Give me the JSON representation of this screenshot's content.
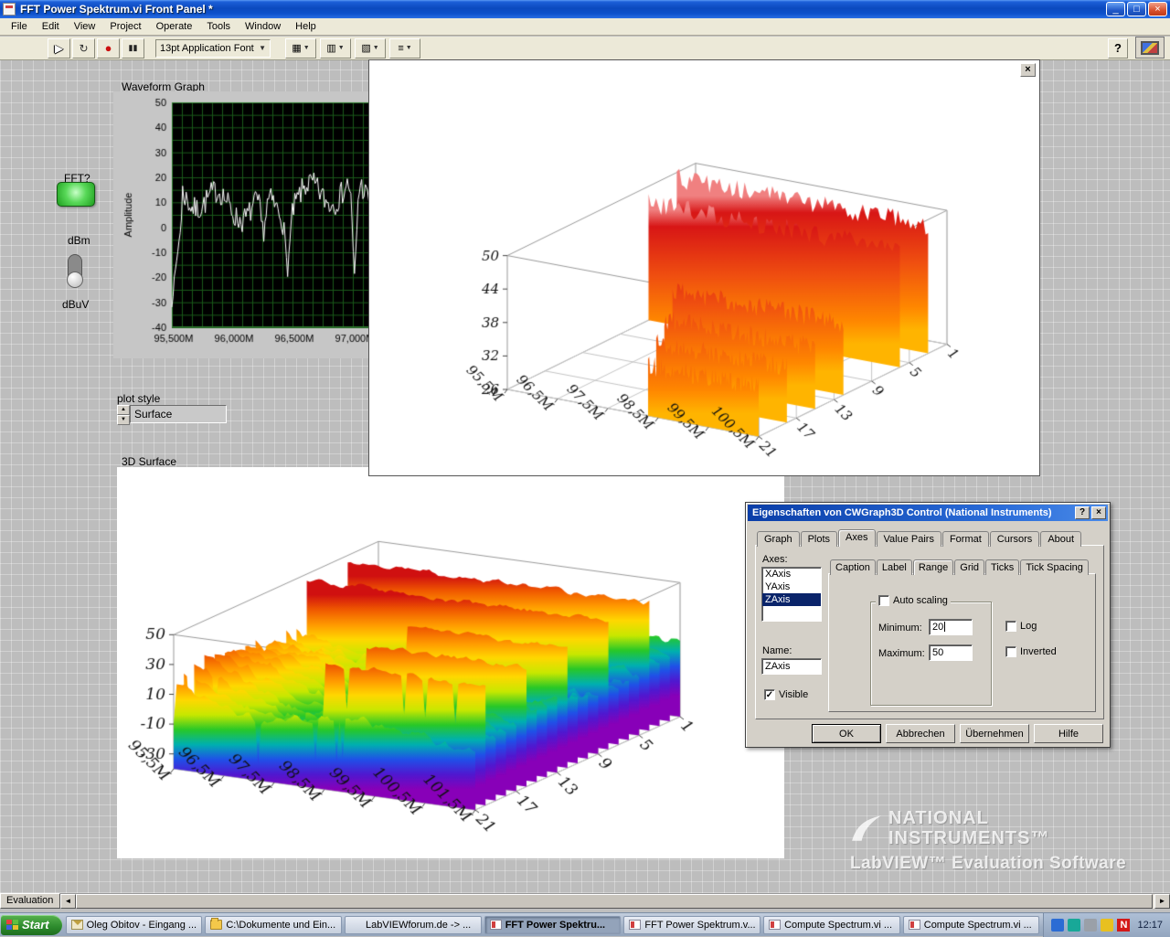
{
  "window": {
    "title": "FFT Power Spektrum.vi Front Panel *",
    "controls": {
      "minimize": "_",
      "maximize": "□",
      "close": "×"
    },
    "menu": [
      "File",
      "Edit",
      "View",
      "Project",
      "Operate",
      "Tools",
      "Window",
      "Help"
    ],
    "toolbar": {
      "run_icon": "▶",
      "run_continuous_icon": "↻",
      "abort_icon": "●",
      "pause_icon": "▮▮",
      "font_selector": "13pt Application Font",
      "dropdown_arrow": "▼",
      "align_icon": "▦",
      "distribute_icon": "▥",
      "resize_icon": "▧",
      "reorder_icon": "≡",
      "help_label": "?"
    }
  },
  "panel": {
    "waveform_label": "Waveform Graph",
    "fft_label": "FFT?",
    "dbm_label": "dBm",
    "dbuv_label": "dBuV",
    "plot_style_label": "plot style",
    "plot_style_value": "Surface",
    "spinner_up": "▲",
    "spinner_down": "▼",
    "surface_label": "3D Surface"
  },
  "float_window": {
    "close": "×"
  },
  "dialog": {
    "title": "Eigenschaften von CWGraph3D Control  (National Instruments)",
    "help_button": "?",
    "close_button": "×",
    "tabs": [
      {
        "label": "Graph"
      },
      {
        "label": "Plots"
      },
      {
        "label": "Axes",
        "active": true
      },
      {
        "label": "Value Pairs"
      },
      {
        "label": "Format"
      },
      {
        "label": "Cursors"
      },
      {
        "label": "About"
      }
    ],
    "axes_label": "Axes:",
    "axes_list": [
      {
        "label": "XAxis"
      },
      {
        "label": "YAxis"
      },
      {
        "label": "ZAxis",
        "selected": true
      }
    ],
    "name_label": "Name:",
    "name_value": "ZAxis",
    "visible_label": "Visible",
    "visible_check": "✓",
    "subtabs": [
      {
        "label": "Caption"
      },
      {
        "label": "Label"
      },
      {
        "label": "Range",
        "active": true
      },
      {
        "label": "Grid"
      },
      {
        "label": "Ticks"
      },
      {
        "label": "Tick Spacing"
      }
    ],
    "auto_scaling_label": "Auto scaling",
    "auto_scaling_check": "",
    "minimum_label": "Minimum:",
    "minimum_value": "20",
    "maximum_label": "Maximum:",
    "maximum_value": "50",
    "log_label": "Log",
    "log_check": "",
    "inverted_label": "Inverted",
    "inverted_check": "",
    "buttons": [
      {
        "label": "OK",
        "default": true
      },
      {
        "label": "Abbrechen"
      },
      {
        "label": "Übernehmen"
      },
      {
        "label": "Hilfe"
      }
    ]
  },
  "watermark": {
    "line1": "NATIONAL",
    "line2": "INSTRUMENTS™",
    "line3": "LabVIEW™ Evaluation Software"
  },
  "statusbar": {
    "evaluation_label": "Evaluation",
    "scroll_left": "◄",
    "scroll_right": "►"
  },
  "taskbar": {
    "start_label": "Start",
    "items": [
      {
        "label": "Oleg Obitov - Eingang ...",
        "icon": "mail"
      },
      {
        "label": "C:\\Dokumente und Ein...",
        "icon": "folder"
      },
      {
        "label": "LabVIEWforum.de -> ...",
        "icon": "ie"
      },
      {
        "label": "FFT Power Spektru...",
        "icon": "labview",
        "active": true
      },
      {
        "label": "FFT Power Spektrum.v...",
        "icon": "labview"
      },
      {
        "label": "Compute Spectrum.vi ...",
        "icon": "labview"
      },
      {
        "label": "Compute Spectrum.vi ...",
        "icon": "labview"
      }
    ],
    "norton_glyph": "N",
    "clock": "12:17"
  },
  "chart_data": [
    {
      "id": "waveform",
      "type": "line",
      "title": "Waveform Graph",
      "ylabel": "Amplitude",
      "ylim": [
        -40,
        50
      ],
      "yticks": [
        50,
        40,
        30,
        20,
        10,
        0,
        -10,
        -20,
        -30,
        -40
      ],
      "xtick_labels": [
        "95,500M",
        "96,000M",
        "96,500M",
        "97,000M"
      ],
      "bg": "#000000",
      "grid_color": "#1a5a1a",
      "line_color": "#ffffff",
      "profile": {
        "start": -30,
        "rise_end_frac": 0.05,
        "mean": 11,
        "wobble": 5,
        "noise": 10,
        "dips": [
          {
            "center": 0.45,
            "depth": 14,
            "width": 0.012
          },
          {
            "center": 0.57,
            "depth": 20,
            "width": 0.012
          },
          {
            "center": 0.9,
            "depth": 38,
            "width": 0.01
          }
        ]
      },
      "seed": 7
    },
    {
      "id": "float3d",
      "type": "3d-curtain",
      "zlim": [
        26,
        50
      ],
      "ztick_values": [
        50,
        44,
        38,
        32,
        26
      ],
      "ztick_labels": [
        "50",
        "44",
        "38",
        "32",
        "26"
      ],
      "xlim": [
        0,
        5
      ],
      "xtick_values": [
        0,
        1,
        2,
        3,
        4,
        5
      ],
      "xtick_labels": [
        "95,5M",
        "96,5M",
        "97,5M",
        "98,5M",
        "99,5M",
        "100,5M"
      ],
      "ylim": [
        1,
        21
      ],
      "ytick_values": [
        1,
        5,
        9,
        13,
        17,
        21
      ],
      "ytick_labels": [
        "1",
        "5",
        "9",
        "13",
        "17",
        "21"
      ],
      "rows": [
        {
          "y": 3,
          "x0": 0,
          "x1": 5,
          "level": 49
        },
        {
          "y": 6,
          "x0": 0,
          "x1": 5,
          "level": 47
        },
        {
          "y": 12,
          "x0": 1.6,
          "x1": 5,
          "level": 39
        },
        {
          "y": 15,
          "x0": 2.0,
          "x1": 5,
          "level": 37
        },
        {
          "y": 18,
          "x0": 2.4,
          "x1": 5,
          "level": 36
        },
        {
          "y": 21,
          "x0": 2.8,
          "x1": 5,
          "level": 35
        }
      ],
      "noise": 1.8,
      "seed": 11,
      "colors": [
        [
          50,
          "#f08080"
        ],
        [
          47,
          "#d81616"
        ],
        [
          38,
          "#f05010"
        ],
        [
          30,
          "#ff8800"
        ],
        [
          26,
          "#ffb400"
        ]
      ]
    },
    {
      "id": "surface3d",
      "type": "3d-surface",
      "zlim": [
        -40,
        50
      ],
      "ztick_values": [
        50,
        30,
        10,
        -10,
        -30
      ],
      "ztick_labels": [
        "50",
        "30",
        "10",
        "-10",
        "-30"
      ],
      "xlim": [
        0,
        6
      ],
      "xtick_values": [
        0,
        1,
        2,
        3,
        4,
        5,
        6
      ],
      "xtick_labels": [
        "95,5M",
        "96,5M",
        "97,5M",
        "98,5M",
        "99,5M",
        "100,5M",
        "101,5M"
      ],
      "ylim": [
        1,
        21
      ],
      "ytick_values": [
        1,
        5,
        9,
        13,
        17,
        21
      ],
      "ytick_labels": [
        "1",
        "5",
        "9",
        "13",
        "17",
        "21"
      ],
      "ridge_rows_full": [
        4,
        8
      ],
      "ridge_rows_partial": [
        12,
        16,
        20
      ],
      "ridge_level": 46,
      "partial_level": 40,
      "partial_x0": 2.8,
      "base_mean": 4,
      "left_hump": 16,
      "noise": 5,
      "seed": 23,
      "colors": [
        [
          50,
          "#d01010"
        ],
        [
          40,
          "#f05800"
        ],
        [
          30,
          "#ff9800"
        ],
        [
          20,
          "#ffd800"
        ],
        [
          10,
          "#c8e800"
        ],
        [
          0,
          "#28c828"
        ],
        [
          -10,
          "#00b0b0"
        ],
        [
          -20,
          "#2050e8"
        ],
        [
          -30,
          "#5018d0"
        ],
        [
          -40,
          "#8800b8"
        ]
      ]
    }
  ]
}
